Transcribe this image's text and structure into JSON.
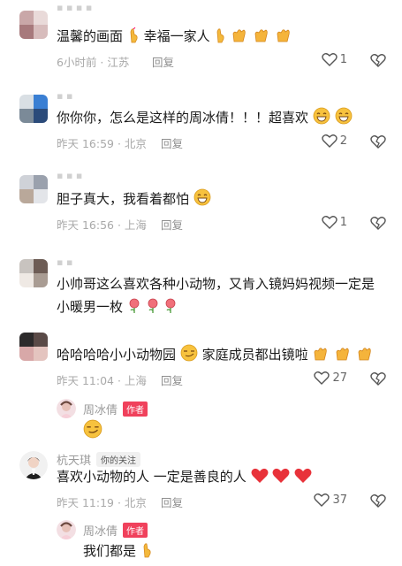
{
  "comments": [
    {
      "text": "温馨的画面",
      "text2": "幸福一家人",
      "time": "6小时前 · 江苏",
      "reply": "回复",
      "likes": "1"
    },
    {
      "text": "你你你，怎么是这样的周冰倩！！！超喜欢",
      "time": "昨天 16:59 · 北京",
      "reply": "回复",
      "likes": "2"
    },
    {
      "text": "胆子真大，我看着都怕",
      "time": "昨天 16:56 · 上海",
      "reply": "回复",
      "likes": "1"
    },
    {
      "text": "小帅哥这么喜欢各种小动物，又肯入镜妈妈视频一定是小暖男一枚",
      "time": "",
      "reply": "",
      "likes": ""
    },
    {
      "text": "哈哈哈哈小小动物园",
      "text2": "家庭成员都出镜啦",
      "time": "昨天 11:04 · 上海",
      "reply": "回复",
      "likes": "27"
    },
    {
      "username": "杭天琪",
      "tag": "你的关注",
      "text": "喜欢小动物的人 一定是善良的人",
      "time": "昨天 11:19 · 北京",
      "reply": "回复",
      "likes": "37"
    }
  ],
  "replies": [
    {
      "username": "周冰倩",
      "badge": "作者",
      "text": ""
    },
    {
      "username": "周冰倩",
      "badge": "作者",
      "text": "我们都是"
    }
  ]
}
